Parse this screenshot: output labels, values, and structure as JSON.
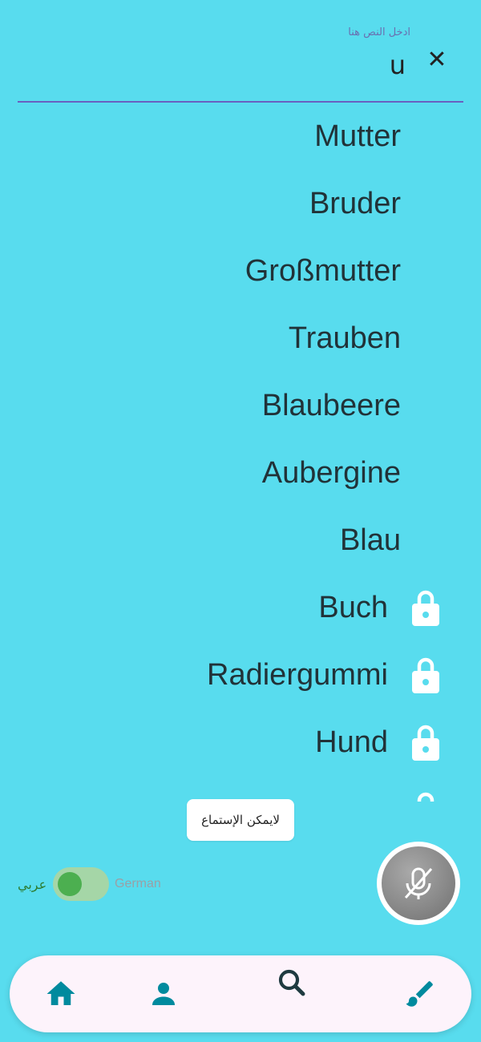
{
  "search": {
    "label": "ادخل النص هنا",
    "value": "u",
    "clear_symbol": "✕"
  },
  "results": [
    {
      "word": "Mutter",
      "locked": false
    },
    {
      "word": "Bruder",
      "locked": false
    },
    {
      "word": "Großmutter",
      "locked": false
    },
    {
      "word": "Trauben",
      "locked": false
    },
    {
      "word": "Blaubeere",
      "locked": false
    },
    {
      "word": "Aubergine",
      "locked": false
    },
    {
      "word": "Blau",
      "locked": false
    },
    {
      "word": "Buch",
      "locked": true
    },
    {
      "word": "Radiergummi",
      "locked": true
    },
    {
      "word": "Hund",
      "locked": true
    }
  ],
  "toast": {
    "message": "لايمكن الإستماع"
  },
  "language_toggle": {
    "left_label": "عربي",
    "right_label": "German"
  },
  "mic": {
    "icon": "mic-off-icon"
  },
  "nav": [
    {
      "id": "home",
      "icon": "home-icon"
    },
    {
      "id": "profile",
      "icon": "person-icon"
    },
    {
      "id": "search",
      "icon": "search-icon"
    },
    {
      "id": "draw",
      "icon": "brush-icon"
    }
  ],
  "colors": {
    "background": "#58dcee",
    "accent": "#008a9e",
    "underline": "#6a5fc0",
    "toggle_on": "#4caf50"
  }
}
